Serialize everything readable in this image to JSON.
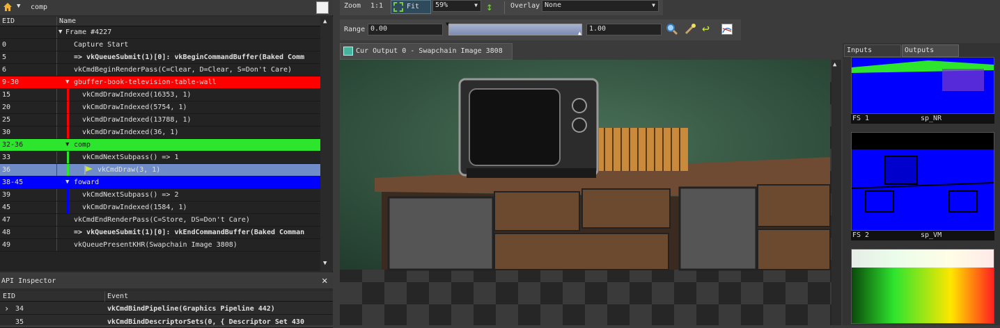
{
  "event_browser": {
    "filter_value": "comp",
    "col_eid": "EID",
    "col_name": "Name",
    "rows": [
      {
        "eid": "",
        "name": "Frame #4227"
      },
      {
        "eid": "0",
        "name": "Capture Start"
      },
      {
        "eid": "5",
        "name": "=>  vkQueueSubmit(1)[0]:  vkBeginCommandBuffer(Baked Comm"
      },
      {
        "eid": "6",
        "name": "vkCmdBeginRenderPass(C=Clear, D=Clear, S=Don't Care)"
      },
      {
        "eid": "9-30",
        "name": "gbuffer-book-television-table-wall"
      },
      {
        "eid": "15",
        "name": "vkCmdDrawIndexed(16353, 1)"
      },
      {
        "eid": "20",
        "name": "vkCmdDrawIndexed(5754, 1)"
      },
      {
        "eid": "25",
        "name": "vkCmdDrawIndexed(13788, 1)"
      },
      {
        "eid": "30",
        "name": "vkCmdDrawIndexed(36, 1)"
      },
      {
        "eid": "32-36",
        "name": "comp"
      },
      {
        "eid": "33",
        "name": "vkCmdNextSubpass() => 1"
      },
      {
        "eid": "36",
        "name": "vkCmdDraw(3, 1)"
      },
      {
        "eid": "38-45",
        "name": "foward"
      },
      {
        "eid": "39",
        "name": "vkCmdNextSubpass() => 2"
      },
      {
        "eid": "45",
        "name": "vkCmdDrawIndexed(1584, 1)"
      },
      {
        "eid": "47",
        "name": "vkCmdEndRenderPass(C=Store, DS=Don't Care)"
      },
      {
        "eid": "48",
        "name": "=>  vkQueueSubmit(1)[0]:  vkEndCommandBuffer(Baked Comman"
      },
      {
        "eid": "49",
        "name": "vkQueuePresentKHR(Swapchain Image 3808)"
      }
    ]
  },
  "api_inspector": {
    "title": "API Inspector",
    "col_eid": "EID",
    "col_event": "Event",
    "rows": [
      {
        "eid": "34",
        "event": "vkCmdBindPipeline(Graphics Pipeline 442)"
      },
      {
        "eid": "35",
        "event": "vkCmdBindDescriptorSets(0, { Descriptor Set 430"
      }
    ]
  },
  "toolbar": {
    "zoom_label": "Zoom",
    "zoom_ratio": "1:1",
    "fit_label": "Fit",
    "zoom_value": "59%",
    "overlay_label": "Overlay",
    "overlay_value": "None",
    "range_label": "Range",
    "range_min": "0.00",
    "range_max": "1.00"
  },
  "output_tab": "Cur Output 0 - Swapchain Image 3808",
  "side_tabs": {
    "inputs": "Inputs",
    "outputs": "Outputs"
  },
  "thumbnails": [
    {
      "slot": "FS 1",
      "name": "sp_NR"
    },
    {
      "slot": "FS 2",
      "name": "sp_VM"
    }
  ],
  "colors": {
    "red": "#ff0000",
    "green": "#2ee52e",
    "blue": "#0000ff",
    "selected": "#6f8cc8"
  }
}
